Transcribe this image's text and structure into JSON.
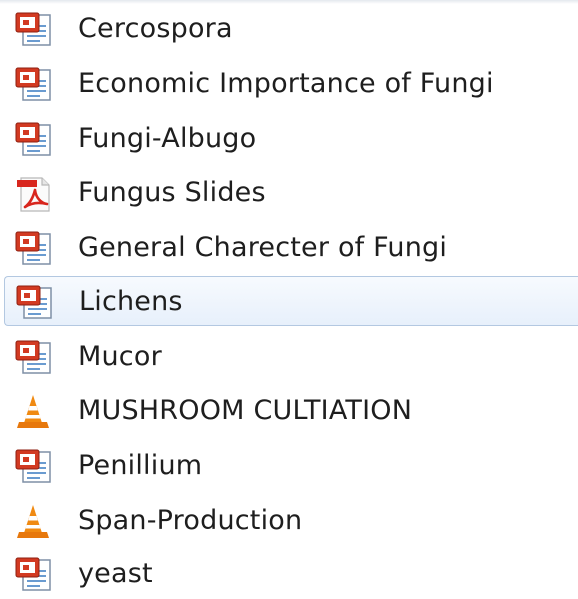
{
  "file_list": {
    "items": [
      {
        "label": "Cercospora",
        "icon": "powerpoint-file-icon"
      },
      {
        "label": "Economic Importance of Fungi",
        "icon": "powerpoint-file-icon"
      },
      {
        "label": "Fungi-Albugo",
        "icon": "powerpoint-file-icon"
      },
      {
        "label": "Fungus Slides",
        "icon": "pdf-file-icon"
      },
      {
        "label": "General Charecter of Fungi",
        "icon": "powerpoint-file-icon"
      },
      {
        "label": "Lichens",
        "icon": "powerpoint-file-icon",
        "selected": true
      },
      {
        "label": "Mucor",
        "icon": "powerpoint-file-icon"
      },
      {
        "label": "MUSHROOM CULTIATION",
        "icon": "vlc-media-file-icon"
      },
      {
        "label": "Penillium",
        "icon": "powerpoint-file-icon"
      },
      {
        "label": "Span-Production",
        "icon": "vlc-media-file-icon"
      },
      {
        "label": "yeast",
        "icon": "powerpoint-file-icon"
      }
    ]
  },
  "colors": {
    "selection_border": "#b3c8e1",
    "selection_fill": "#e7f0fb",
    "powerpoint_red": "#d23a22",
    "pdf_red": "#d8261e",
    "vlc_orange": "#f08a12"
  }
}
